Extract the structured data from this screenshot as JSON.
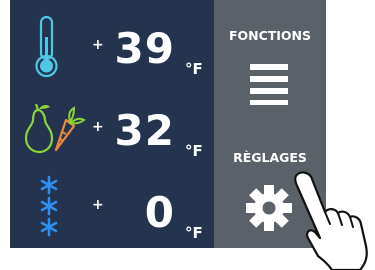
{
  "colors": {
    "panel_bg": "#24344f",
    "side_bg": "#5b6169",
    "accent": "#4fc7e6",
    "green": "#8cd33a",
    "snow": "#2e8ff0"
  },
  "rows": [
    {
      "icon": "thermometer-icon",
      "sign": "+",
      "value": "39",
      "unit": "°F"
    },
    {
      "icon": "fruit-vegetable-icon",
      "sign": "+",
      "value": "32",
      "unit": "°F"
    },
    {
      "icon": "snowflake-icon",
      "sign": "+",
      "value": "0",
      "unit": "°F"
    }
  ],
  "side": {
    "functions_label": "FONCTIONS",
    "functions_icon": "menu-icon",
    "settings_label": "RÈGLAGES",
    "settings_icon": "gear-icon"
  },
  "overlay": {
    "icon": "pointing-hand-icon"
  }
}
